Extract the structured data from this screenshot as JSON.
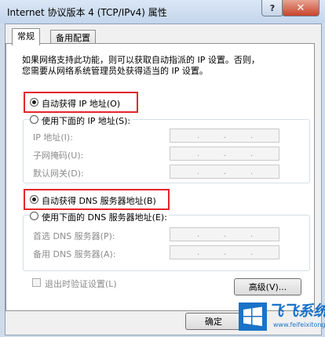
{
  "window": {
    "title": "Internet 协议版本 4 (TCP/IPv4) 属性",
    "help_glyph": "?",
    "close_glyph": "✕"
  },
  "tabs": [
    {
      "label": "常规",
      "active": true
    },
    {
      "label": "备用配置",
      "active": false
    }
  ],
  "description": [
    "如果网络支持此功能，则可以获取自动指派的 IP 设置。否则，",
    "您需要从网络系统管理员处获得适当的 IP 设置。"
  ],
  "ip_section": {
    "auto_label": "自动获得 IP 地址(O)",
    "manual_label": "使用下面的 IP 地址(S):",
    "fields": [
      {
        "label": "IP 地址(I):",
        "dots": [
          ".",
          ".",
          "."
        ]
      },
      {
        "label": "子网掩码(U):",
        "dots": [
          ".",
          ".",
          "."
        ]
      },
      {
        "label": "默认网关(D):",
        "dots": [
          ".",
          ".",
          "."
        ]
      }
    ]
  },
  "dns_section": {
    "auto_label": "自动获得 DNS 服务器地址(B)",
    "manual_label": "使用下面的 DNS 服务器地址(E):",
    "fields": [
      {
        "label": "首选 DNS 服务器(P):",
        "dots": [
          ".",
          ".",
          "."
        ]
      },
      {
        "label": "备用 DNS 服务器(A):",
        "dots": [
          ".",
          ".",
          "."
        ]
      }
    ]
  },
  "validate_label": "退出时验证设置(L)",
  "advanced_label": "高级(V)...",
  "ok_label": "确定",
  "watermark": {
    "name": "飞飞系统",
    "url": "www.feifeixitong.com"
  },
  "colors": {
    "highlight": "#e3262b",
    "accent": "#1a73c8"
  }
}
